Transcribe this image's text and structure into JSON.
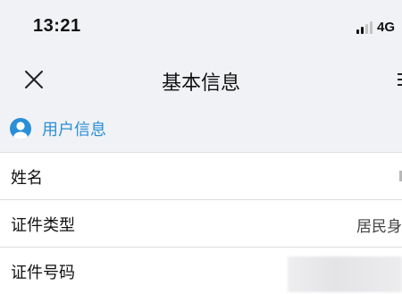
{
  "status_bar": {
    "time": "13:21",
    "network": "4G",
    "signal_icon": "signal-bars-icon",
    "signal_bars_active": 2,
    "signal_bars_total": 4
  },
  "header": {
    "title": "基本信息",
    "close_icon": "close-icon"
  },
  "section": {
    "title": "用户信息",
    "icon": "user-icon",
    "accent_color": "#2a8fd6"
  },
  "form": {
    "rows": [
      {
        "label": "姓名",
        "value": ""
      },
      {
        "label": "证件类型",
        "value": "居民身"
      },
      {
        "label": "证件号码",
        "value": ""
      }
    ]
  }
}
